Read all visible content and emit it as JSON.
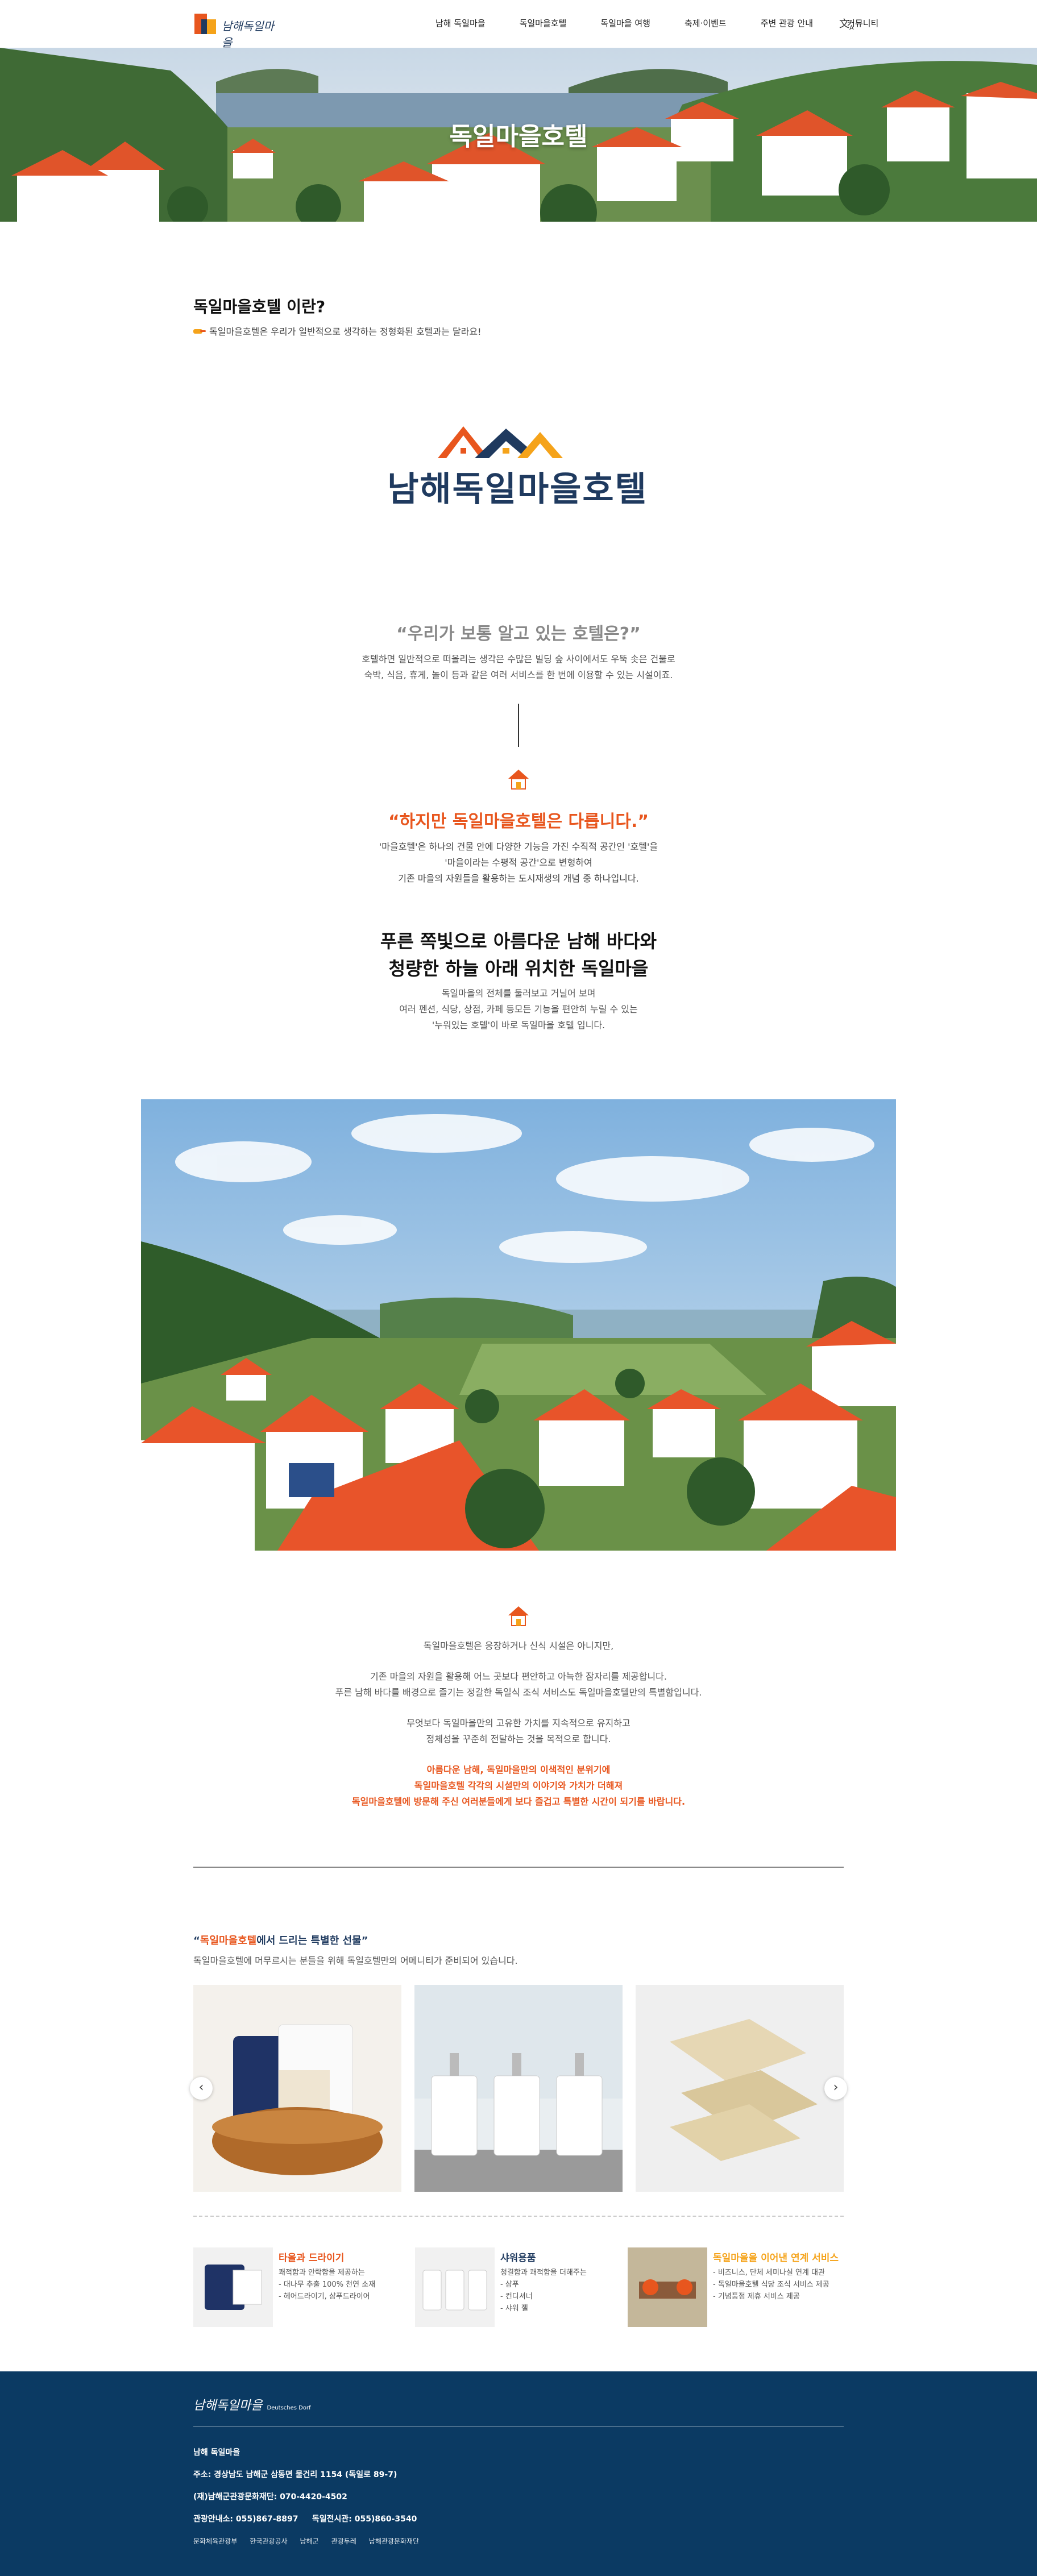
{
  "header": {
    "logo_text": "남해독일마을",
    "nav": [
      "남해 독일마을",
      "독일마을호텔",
      "독일마을 여행",
      "축제·이벤트",
      "주변 관광 안내",
      "커뮤니티"
    ],
    "lang_icon": "translate-icon"
  },
  "hero": {
    "title": "독일마을호텔"
  },
  "intro": {
    "title": "독일마을호텔 이란?",
    "subtitle": "독일마을호텔은 우리가 일반적으로 생각하는 정형화된 호텔과는 달라요!"
  },
  "brand": {
    "logo_text": "남해독일마을호텔"
  },
  "question": {
    "title": "“우리가 보통 알고 있는 호텔은?”",
    "lines": [
      "호텔하면 일반적으로 떠올리는 생각은 수많은 빌딩 숲 사이에서도 우뚝 솟은 건물로",
      "숙박, 식음, 휴게, 놀이 등과 같은 여러 서비스를 한 번에 이용할 수 있는 시설이죠."
    ]
  },
  "emphasis": {
    "title": "“하지만 독일마을호텔은 다릅니다.”",
    "lines": [
      "'마을호텔'은 하나의 건물 안에 다양한 기능을 가진 수직적 공간인 '호텔'을",
      "'마을이라는 수평적 공간'으로 변형하여",
      "기존 마을의 자원들을 활용하는 도시재생의 개념 중 하나입니다."
    ]
  },
  "blue": {
    "title_lines": [
      "푸른 쪽빛으로 아름다운 남해 바다와",
      "청량한 하늘 아래 위치한 독일마을"
    ],
    "lines": [
      "독일마을의 전체를 둘러보고 거닐어 보며",
      "여러 펜션, 식당, 상점, 카페 등모든 기능을 편안히 누릴 수 있는",
      "'누워있는 호텔'이 바로 독일마을 호텔 입니다."
    ]
  },
  "description": {
    "p1": [
      "독일마을호텔은 웅장하거나 신식 시설은 아니지만,"
    ],
    "p2": [
      "기존 마을의 자원을 활용해 어느 곳보다 편안하고 아늑한 잠자리를 제공합니다.",
      "푸른 남해 바다를 배경으로 즐기는 정갈한 독일식 조식 서비스도 독일마을호텔만의 특별함입니다."
    ],
    "p3": [
      "무엇보다 독일마을만의 고유한 가치를 지속적으로 유지하고",
      "정체성을 꾸준히 전달하는 것을 목적으로 합니다."
    ],
    "p4": [
      "아름다운 남해, 독일마을만의 이색적인 분위기에",
      "독일마을호텔 각각의 시설만의 이야기와 가치가 더해져",
      "독일마을호텔에 방문해 주신 여러분들에게 보다 즐겁고 특별한 시간이 되기를 바랍니다."
    ]
  },
  "gifts": {
    "title_prefix": "“",
    "title_highlight": "독일마을호텔",
    "title_suffix": "에서 드리는 특별한 선물”",
    "subtitle": "독일마을호텔에 머무르시는 분들을 위해 독일호텔만의 어메니티가 준비되어 있습니다.",
    "prev": "‹",
    "next": "›"
  },
  "amenities": [
    {
      "title": "타올과 드라이기",
      "color": "#e8561e",
      "lines": [
        "쾌적함과 안락함을 제공하는",
        "- 대나무 추출 100% 천연 소재",
        "- 헤어드라이기, 샴푸드라이어"
      ]
    },
    {
      "title": "샤워용품",
      "color": "#1f3a5f",
      "lines": [
        "청결함과 쾌적함을 더해주는",
        "- 샴푸",
        "- 컨디셔너",
        "- 샤워 젤"
      ]
    },
    {
      "title": "독일마을을 이어낸 연계 서비스",
      "color": "#f5a31a",
      "lines": [
        "- 비즈니스, 단체 세미나실 연계 대관",
        "- 독일마을호텔 식당 조식 서비스 제공",
        "- 기념품점 제휴 서비스 제공"
      ]
    }
  ],
  "footer": {
    "logo_text": "남해독일마을",
    "logo_small": "Deutsches Dorf",
    "info": [
      "남해 독일마을",
      "주소: 경상남도 남해군 삼동면 물건리 1154 (독일로 89-7)",
      "(재)남해군관광문화재단: 070-4420-4502",
      "관광안내소: 055)867-8897     독일전시관: 055)860-3540"
    ],
    "partners": [
      "문화체육관광부",
      "한국관광공사",
      "남해군",
      "관광두레",
      "남해관광문화재단"
    ]
  }
}
